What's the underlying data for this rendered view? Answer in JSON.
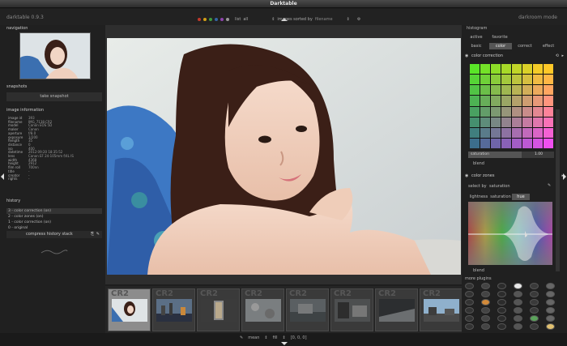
{
  "window_title": "Darktable",
  "brand": "darktable 0.9.3",
  "mode": "darkroom mode",
  "topbar": {
    "list_label": "list",
    "filter_value": "all",
    "sort_label": "images sorted by",
    "sort_value": "filename",
    "color_labels": [
      "#c0392b",
      "#d4a017",
      "#3d9a3d",
      "#3465a4",
      "#8e44ad",
      "#999999"
    ]
  },
  "left": {
    "navigation": "navigation",
    "snapshots": "snapshots",
    "take_snapshot": "take snapshot",
    "image_information": "image information",
    "info_rows": [
      {
        "k": "image id",
        "v": "393"
      },
      {
        "k": "filename",
        "v": "IMG_7138.CR2"
      },
      {
        "k": "model",
        "v": "Canon EOS 5D"
      },
      {
        "k": "maker",
        "v": "Canon"
      },
      {
        "k": "aperture",
        "v": "f/8.0"
      },
      {
        "k": "exposure",
        "v": "1/200"
      },
      {
        "k": "flength",
        "v": "35"
      },
      {
        "k": "distance",
        "v": "0"
      },
      {
        "k": "iso",
        "v": "400"
      },
      {
        "k": "datetime",
        "v": "2012:09:20 18:35:52"
      },
      {
        "k": "lens",
        "v": "Canon EF 24-105mm f/4L IS"
      },
      {
        "k": "width",
        "v": "4368"
      },
      {
        "k": "height",
        "v": "2912"
      },
      {
        "k": "film roll",
        "v": "700nn"
      },
      {
        "k": "title",
        "v": "-"
      },
      {
        "k": "creator",
        "v": "-"
      },
      {
        "k": "rights",
        "v": "-"
      }
    ],
    "history": "history",
    "history_items": [
      "3 - color correction (on)",
      "2 - color zones (on)",
      "1 - color correction (on)",
      "0 - original"
    ],
    "compress_history": "compress history stack"
  },
  "right": {
    "histogram": "histogram",
    "groups": [
      "active",
      "favorite",
      "basic",
      "color",
      "correct",
      "effect"
    ],
    "color_correction": "color correction",
    "saturation_label": "saturation",
    "saturation_value": "1.00",
    "saturation_fraction": 0.62,
    "blend": "blend",
    "color_zones": "color zones",
    "select_by_label": "select by",
    "select_by_value": "saturation",
    "zone_tabs": [
      "lightness",
      "saturation",
      "hue"
    ],
    "blend2": "blend",
    "more_plugins": "more plugins"
  },
  "bottom": {
    "zoom_label": "mean",
    "zoom_value": "fill",
    "coords": "[0, 0, 0]"
  },
  "filmstrip": {
    "labels": [
      "CR2",
      "CR2",
      "CR2",
      "CR2",
      "CR2",
      "CR2",
      "CR2",
      "CR2"
    ]
  }
}
